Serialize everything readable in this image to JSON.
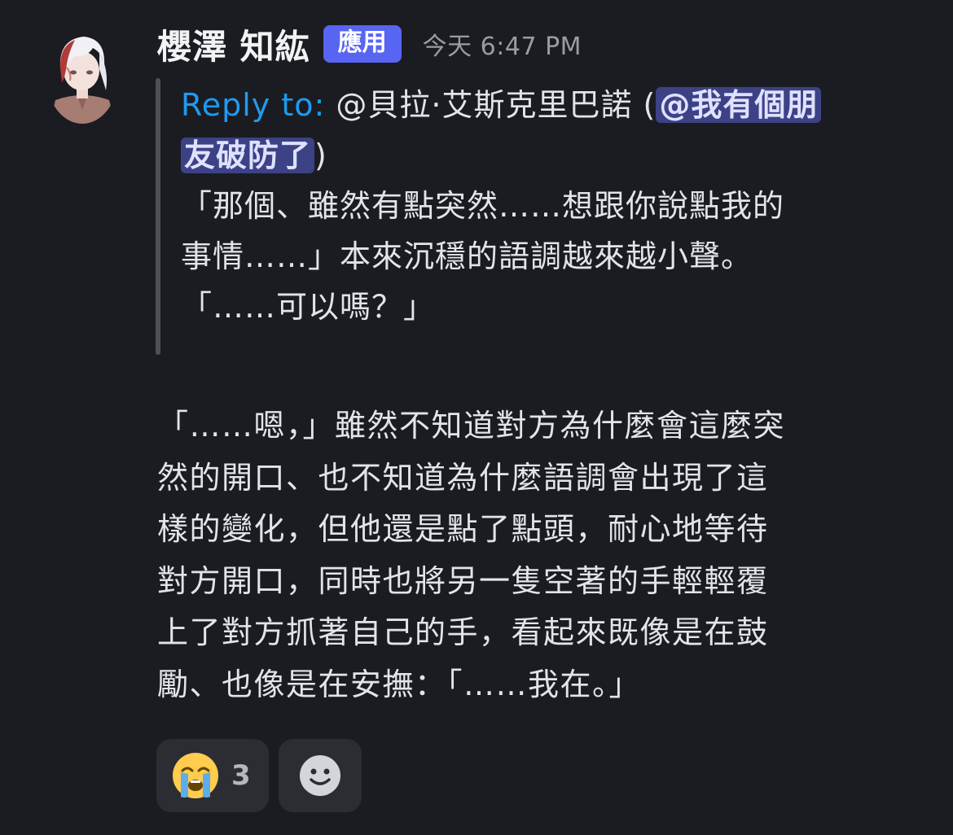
{
  "author": {
    "name": "櫻澤 知紘",
    "badge": "應用",
    "timestamp": "今天 6:47 PM"
  },
  "reply": {
    "label": "Reply to:",
    "target": " @貝拉·艾斯克里巴諾 (",
    "mention_part1": "@我有個朋",
    "mention_part2": "友破防了",
    "close_paren": ")",
    "lines": [
      "「那個、雖然有點突然……想跟你說點我的",
      "事情……」本來沉穩的語調越來越小聲。",
      "「……可以嗎？」"
    ]
  },
  "message": {
    "lines": [
      "「……嗯，」雖然不知道對方為什麼會這麼突",
      "然的開口、也不知道為什麼語調會出現了這",
      "樣的變化，但他還是點了點頭，耐心地等待",
      "對方開口，同時也將另一隻空著的手輕輕覆",
      "上了對方抓著自己的手，看起來既像是在鼓",
      "勵、也像是在安撫：「……我在。」"
    ]
  },
  "reactions": [
    {
      "emoji": "crying-face",
      "count": "3"
    }
  ],
  "add_reaction": {
    "icon": "smiley-face-icon"
  },
  "colors": {
    "background": "#1b1c21",
    "accent": "#5865f2",
    "reply_label": "#1e9bf0",
    "mention_bg": "#3c4285"
  }
}
